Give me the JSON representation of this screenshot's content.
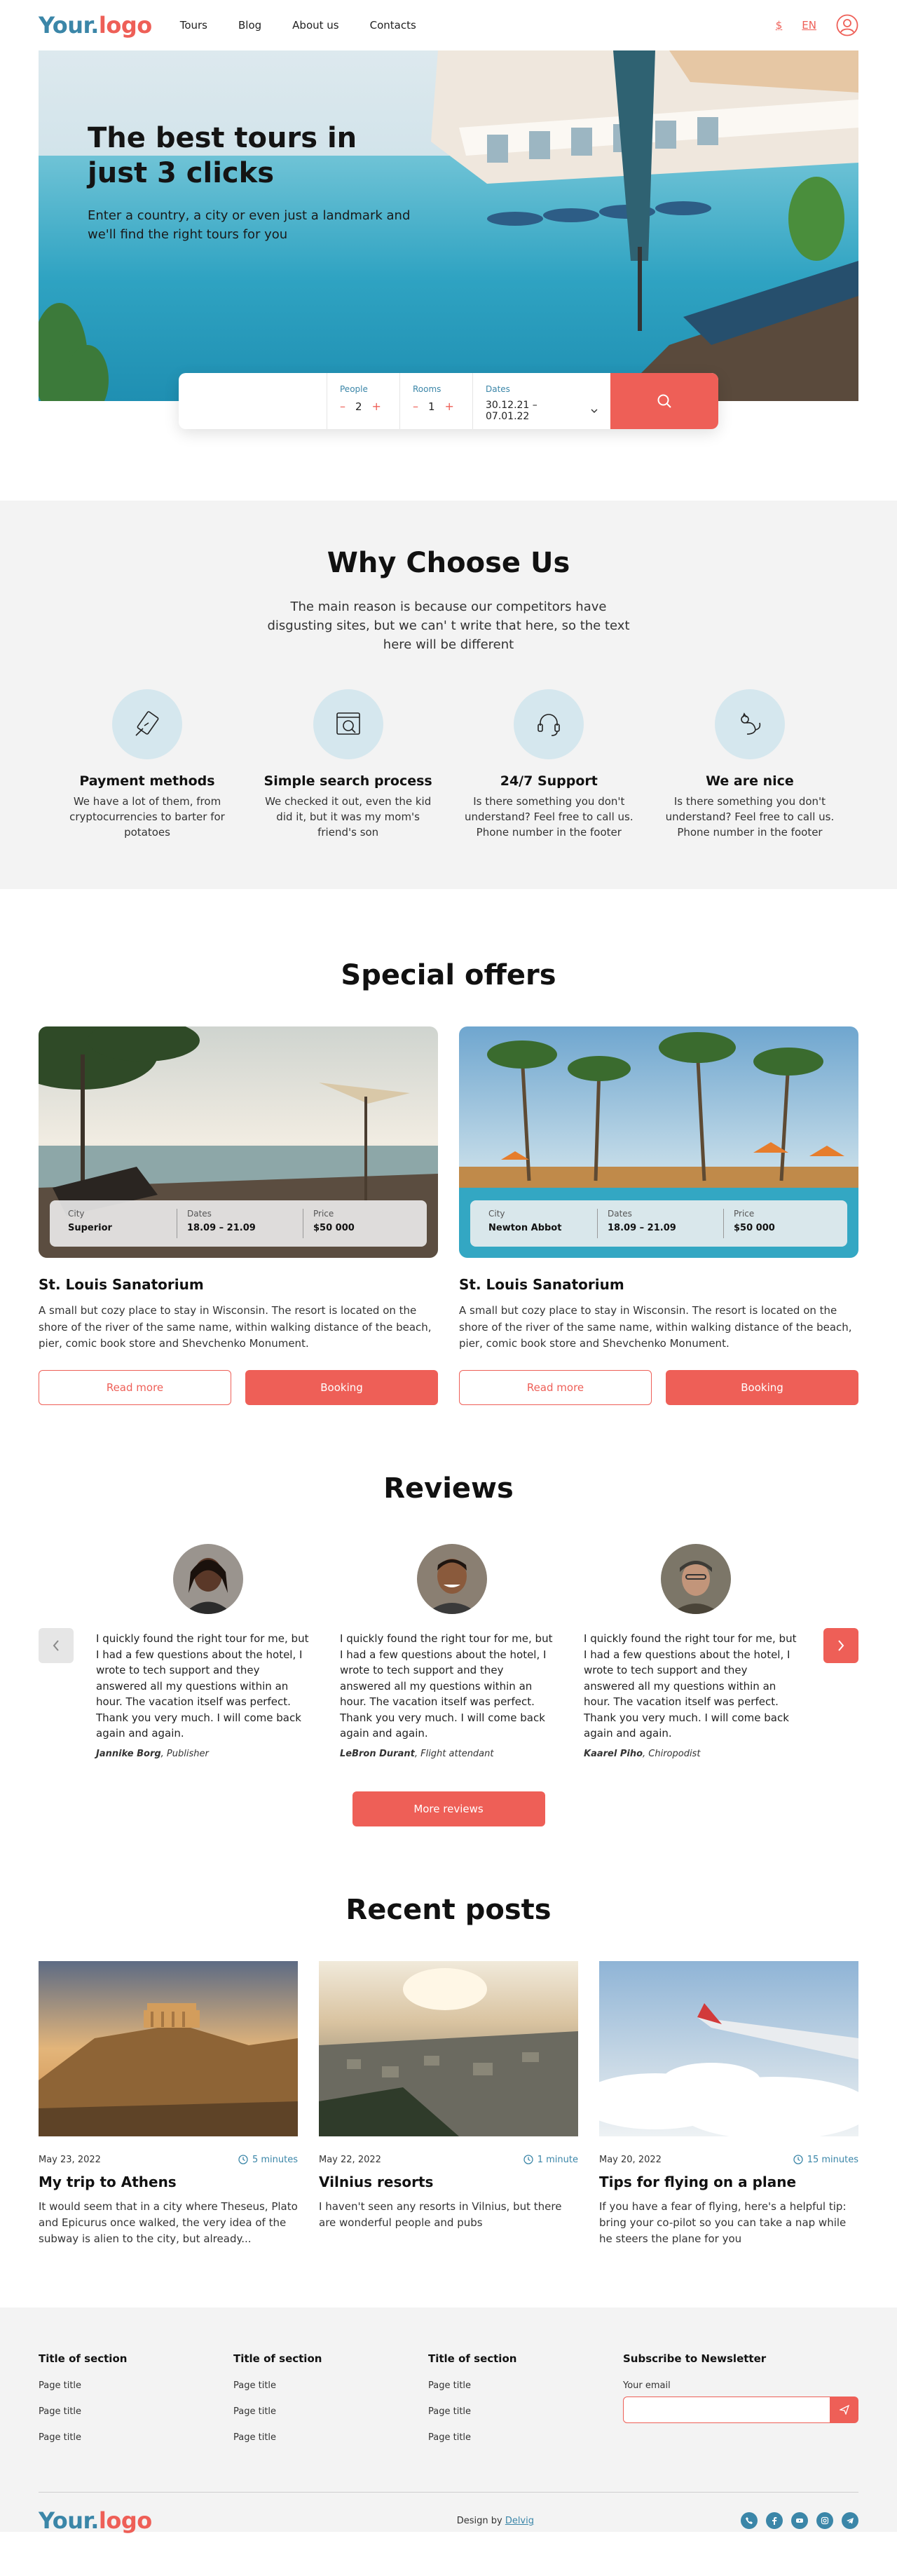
{
  "header": {
    "logo_part1": "Your.",
    "logo_part2": "logo",
    "nav": [
      "Tours",
      "Blog",
      "About us",
      "Contacts"
    ],
    "currency": "$",
    "language": "EN"
  },
  "hero": {
    "title": "The best tours in just 3 clicks",
    "subtitle": "Enter a country, a city or even just a landmark and we'll find the right tours for you"
  },
  "search": {
    "people_label": "People",
    "people_value": "2",
    "rooms_label": "Rooms",
    "rooms_value": "1",
    "dates_label": "Dates",
    "dates_value": "30.12.21 – 07.01.22",
    "minus": "–",
    "plus": "+"
  },
  "why": {
    "title": "Why Choose Us",
    "subtitle": "The main reason is because our competitors have disgusting sites, but we can' t write that here, so the text here will be different",
    "features": [
      {
        "title": "Payment methods",
        "desc": "We have a lot of them, from cryptocurrencies to barter for potatoes",
        "icon": "card-icon"
      },
      {
        "title": "Simple search process",
        "desc": "We checked it out, even the kid did it, but it was my mom's friend's son",
        "icon": "browser-search-icon"
      },
      {
        "title": "24/7 Support",
        "desc": "Is there something you don't understand? Feel free to call us. Phone number in the footer",
        "icon": "headset-icon"
      },
      {
        "title": "We are nice",
        "desc": "Is there something you don't understand? Feel free to call us. Phone number in the footer",
        "icon": "cat-icon"
      }
    ]
  },
  "offers": {
    "title": "Special offers",
    "labels": {
      "city": "City",
      "dates": "Dates",
      "price": "Price"
    },
    "read_more": "Read more",
    "booking": "Booking",
    "items": [
      {
        "city": "Superior",
        "dates": "18.09 – 21.09",
        "price": "$50 000",
        "name": "St. Louis Sanatorium",
        "desc": "A small but cozy place to stay in Wisconsin. The resort is located on the shore of the river of the same name, within walking distance of the beach, pier, comic book store and Shevchenko Monument."
      },
      {
        "city": "Newton Abbot",
        "dates": "18.09 – 21.09",
        "price": "$50 000",
        "name": "St. Louis Sanatorium",
        "desc": "A small but cozy place to stay in Wisconsin. The resort is located on the shore of the river of the same name, within walking distance of the beach, pier, comic book store and Shevchenko Monument."
      }
    ]
  },
  "reviews": {
    "title": "Reviews",
    "more": "More reviews",
    "items": [
      {
        "text": "I quickly found the right tour for me, but I had a few questions about the hotel, I wrote to tech support and they answered all my questions within an hour. The vacation itself was perfect. Thank you very much. I will come back again and again.",
        "name": "Jannike Borg",
        "role": ", Publisher"
      },
      {
        "text": "I quickly found the right tour for me, but I had a few questions about the hotel, I wrote to tech support and they answered all my questions within an hour. The vacation itself was perfect. Thank you very much. I will come back again and again.",
        "name": "LeBron Durant",
        "role": ", Flight attendant"
      },
      {
        "text": "I quickly found the right tour for me, but I had a few questions about the hotel, I wrote to tech support and they answered all my questions within an hour. The vacation itself was perfect. Thank you very much. I will come back again and again.",
        "name": "Kaarel Piho",
        "role": ", Chiropodist"
      }
    ]
  },
  "posts": {
    "title": "Recent posts",
    "items": [
      {
        "date": "May 23, 2022",
        "time": "5 minutes",
        "title": "My trip to Athens",
        "desc": "It would seem that in a city where Theseus, Plato and Epicurus once walked, the very idea of the subway is alien to the city, but already..."
      },
      {
        "date": "May 22, 2022",
        "time": "1 minute",
        "title": "Vilnius resorts",
        "desc": "I haven't seen any resorts in Vilnius, but there are wonderful people and pubs"
      },
      {
        "date": "May 20, 2022",
        "time": "15 minutes",
        "title": "Tips for flying on a plane",
        "desc": "If you have a fear of flying, here's a helpful tip: bring your co-pilot so you can take a nap while he steers the plane for you"
      }
    ]
  },
  "footer": {
    "columns": [
      {
        "title": "Title of section",
        "links": [
          "Page title",
          "Page title",
          "Page title"
        ]
      },
      {
        "title": "Title of section",
        "links": [
          "Page title",
          "Page title",
          "Page title"
        ]
      },
      {
        "title": "Title of section",
        "links": [
          "Page title",
          "Page title",
          "Page title"
        ]
      }
    ],
    "newsletter_title": "Subscribe to Newsletter",
    "email_label": "Your email",
    "design_by": "Design by ",
    "designer": "Delvig",
    "socials": [
      "phone-icon",
      "facebook-icon",
      "youtube-icon",
      "instagram-icon",
      "telegram-icon"
    ]
  },
  "colors": {
    "accent": "#ee5f57",
    "brand": "#3b86a8",
    "bg_gray": "#f3f3f3"
  }
}
